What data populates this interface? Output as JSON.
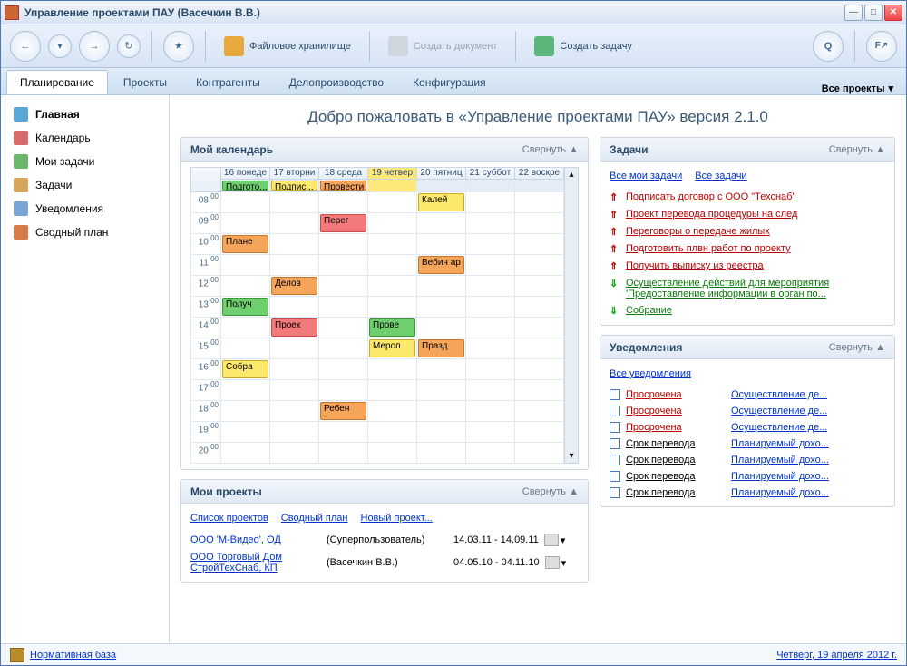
{
  "window": {
    "title": "Управление проектами ПАУ (Васечкин В.В.)"
  },
  "toolbar": {
    "file_storage": "Файловое хранилище",
    "create_doc": "Создать документ",
    "create_task": "Создать задачу"
  },
  "tabs": [
    {
      "label": "Планирование",
      "active": true
    },
    {
      "label": "Проекты"
    },
    {
      "label": "Контрагенты"
    },
    {
      "label": "Делопроизводство"
    },
    {
      "label": "Конфигурация"
    }
  ],
  "tabs_right": "Все проекты",
  "sidebar": [
    {
      "label": "Главная",
      "color": "#5aa6d6",
      "active": true
    },
    {
      "label": "Календарь",
      "color": "#d66a6a"
    },
    {
      "label": "Мои задачи",
      "color": "#6ab66a"
    },
    {
      "label": "Задачи",
      "color": "#d6a65a"
    },
    {
      "label": "Уведомления",
      "color": "#7aa6d6"
    },
    {
      "label": "Сводный план",
      "color": "#d67a4a"
    }
  ],
  "welcome": "Добро пожаловать в «Управление проектами ПАУ» версия 2.1.0",
  "panels": {
    "calendar_title": "Мой календарь",
    "tasks_title": "Задачи",
    "notif_title": "Уведомления",
    "projects_title": "Мои проекты",
    "collapse": "Свернуть"
  },
  "task_links": {
    "mine": "Все мои задачи",
    "all": "Все задачи"
  },
  "tasks": [
    {
      "txt": "Подписать договор с ООО \"Техснаб\"",
      "dir": "up"
    },
    {
      "txt": "Проект перевода процедуры на след",
      "dir": "up"
    },
    {
      "txt": "Переговоры о передаче жилых",
      "dir": "up"
    },
    {
      "txt": "Подготовить плвн работ по проекту",
      "dir": "up"
    },
    {
      "txt": "Получить выписку из реестра",
      "dir": "up"
    },
    {
      "txt": "Осуществление действий для мероприятия 'Предоставление информации в орган по...",
      "dir": "down"
    },
    {
      "txt": "Собрание",
      "dir": "down"
    }
  ],
  "notif_link": "Все уведомления",
  "notifs": [
    {
      "t1": "Просрочена",
      "t2": "Осуществление де...",
      "red": true
    },
    {
      "t1": "Просрочена",
      "t2": "Осуществление де...",
      "red": true
    },
    {
      "t1": "Просрочена",
      "t2": "Осуществление де...",
      "red": true
    },
    {
      "t1": "Срок перевода",
      "t2": "Планируемый дохо...",
      "red": false
    },
    {
      "t1": "Срок перевода",
      "t2": "Планируемый дохо...",
      "red": false
    },
    {
      "t1": "Срок перевода",
      "t2": "Планируемый дохо...",
      "red": false
    },
    {
      "t1": "Срок перевода",
      "t2": "Планируемый дохо...",
      "red": false
    }
  ],
  "proj_links": {
    "list": "Список проектов",
    "summary": "Сводный план",
    "new": "Новый проект..."
  },
  "projects": [
    {
      "nm": "ООО 'М-Видео', ОД",
      "own": "(Суперпользователь)",
      "dt": "14.03.11 - 14.09.11"
    },
    {
      "nm": "ООО Торговый Дом СтройТехСнаб, КП",
      "own": "(Васечкин В.В.)",
      "dt": "04.05.10 - 04.11.10"
    }
  ],
  "calendar": {
    "times": [
      "08",
      "09",
      "10",
      "11",
      "12",
      "13",
      "14",
      "15",
      "16",
      "17",
      "18",
      "19",
      "20"
    ],
    "days": [
      {
        "hd": "16 понеде",
        "allday": {
          "txt": "Подгото...",
          "cls": "g"
        },
        "ev": [
          {
            "row": 2,
            "txt": "Плане",
            "cls": "o"
          },
          {
            "row": 5,
            "txt": "Получ",
            "cls": "g"
          },
          {
            "row": 8,
            "txt": "Собра",
            "cls": "y"
          }
        ]
      },
      {
        "hd": "17 вторни",
        "allday": {
          "txt": "Подпис...",
          "cls": "y"
        },
        "ev": [
          {
            "row": 4,
            "txt": "Делов",
            "cls": "o"
          },
          {
            "row": 6,
            "txt": "Проек",
            "cls": "r"
          }
        ]
      },
      {
        "hd": "18 среда",
        "allday": {
          "txt": "Провести",
          "cls": "o"
        },
        "ev": [
          {
            "row": 1,
            "txt": "Перег",
            "cls": "r"
          },
          {
            "row": 10,
            "txt": "Ребен",
            "cls": "o"
          }
        ]
      },
      {
        "hd": "19 четвер",
        "today": true,
        "ev": [
          {
            "row": 6,
            "txt": "Прове",
            "cls": "g"
          },
          {
            "row": 7,
            "txt": "Мероп",
            "cls": "y"
          }
        ]
      },
      {
        "hd": "20 пятниц",
        "ev": [
          {
            "row": 0,
            "txt": "Калей",
            "cls": "y"
          },
          {
            "row": 3,
            "txt": "Вебин ар",
            "cls": "o"
          },
          {
            "row": 7,
            "txt": "Празд",
            "cls": "o"
          }
        ]
      },
      {
        "hd": "21 суббот",
        "ev": []
      },
      {
        "hd": "22 воскре",
        "ev": []
      }
    ]
  },
  "footer": {
    "left": "Нормативная база",
    "right": "Четверг, 19 апреля 2012 г."
  }
}
